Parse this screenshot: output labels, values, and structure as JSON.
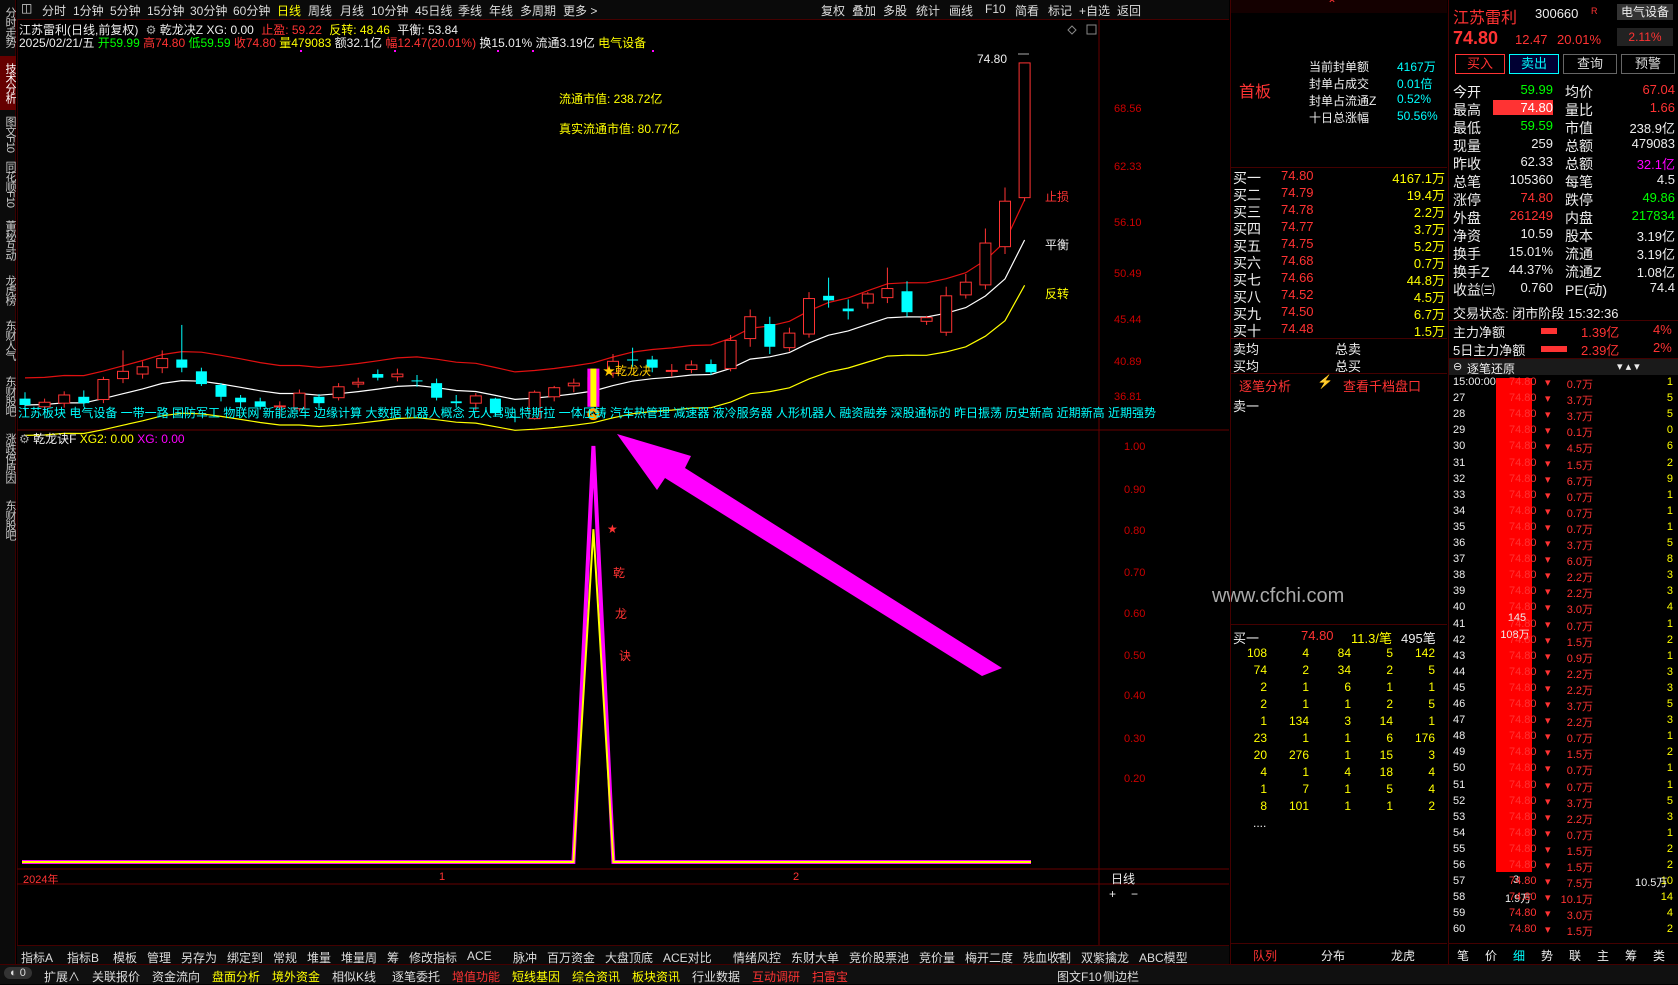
{
  "left_tabs": [
    "分时走势",
    "技术分析",
    "图文F10",
    "同花顺F10",
    "董秘互动",
    "龙虎榜",
    "东财人气",
    "东财股吧",
    "涨跌停原因",
    "东财股吧"
  ],
  "periods": [
    "分时",
    "1分钟",
    "5分钟",
    "15分钟",
    "30分钟",
    "60分钟",
    "日线",
    "周线",
    "月线",
    "10分钟",
    "45日线",
    "季线",
    "年线",
    "多周期",
    "更多 >"
  ],
  "active_period": "日线",
  "toolbar_right": [
    "复权",
    "叠加",
    "多股",
    "统计",
    "画线",
    "F10",
    "简看",
    "标记",
    "+自选",
    "返回"
  ],
  "chart": {
    "title": "江苏雷利(日线,前复权)",
    "indicator_name": "乾龙决Z",
    "xg": "XG: 0.00",
    "stop": "止盈: 59.22",
    "reverse": "反转: 48.46",
    "balance": "平衡: 53.84",
    "date": "2025/02/21/五",
    "open": "开59.99",
    "high": "高74.80",
    "low": "低59.59",
    "close": "收74.80",
    "vol": "量479083",
    "amount": "额32.1亿",
    "chg": "幅12.47(20.01%)",
    "turnover": "换15.01%",
    "float": "流通3.19亿",
    "sector": "电气设备",
    "annot1": "流通市值: 238.72亿",
    "annot2": "真实流通市值: 80.77亿",
    "price_max": "74.80",
    "signal": "★乾龙决",
    "line_labels": {
      "stop": "止损",
      "balance": "平衡",
      "reverse": "反转"
    },
    "yaxis": [
      "68.56",
      "62.33",
      "56.10",
      "50.49",
      "45.44",
      "40.89",
      "36.81"
    ],
    "concepts": "江苏板块 电气设备 一带一路 国防军工 物联网 新能源车 边缘计算 大数据 机器人概念 无人驾驶 特斯拉 一体压铸 汽车热管理 减速器 液冷服务器 人形机器人 融资融券 深股通标的 昨日振荡 历史新高 近期新高 近期强势"
  },
  "sub": {
    "name": "乾龙诀F",
    "xg2": "XG2: 0.00",
    "xg": "XG: 0.00",
    "yaxis": [
      "1.00",
      "0.90",
      "0.80",
      "0.70",
      "0.60",
      "0.50",
      "0.40",
      "0.30",
      "0.20"
    ],
    "star": "★",
    "vtext": [
      "乾",
      "龙",
      "诀"
    ],
    "watermark": "www.cfchi.com",
    "xlabels": [
      "2024年",
      "1",
      "2"
    ],
    "period_label": "日线"
  },
  "chart_data": {
    "type": "candlestick",
    "ylim": [
      35,
      76
    ],
    "candles": [
      {
        "o": 37.9,
        "h": 38.6,
        "l": 36.6,
        "c": 37.2
      },
      {
        "o": 37.0,
        "h": 37.9,
        "l": 36.3,
        "c": 37.5
      },
      {
        "o": 37.4,
        "h": 38.7,
        "l": 36.9,
        "c": 38.3
      },
      {
        "o": 38.1,
        "h": 38.8,
        "l": 37.0,
        "c": 37.4
      },
      {
        "o": 37.8,
        "h": 40.3,
        "l": 37.4,
        "c": 40.0
      },
      {
        "o": 40.1,
        "h": 43.2,
        "l": 39.6,
        "c": 40.9
      },
      {
        "o": 40.6,
        "h": 42.0,
        "l": 40.1,
        "c": 41.4
      },
      {
        "o": 41.3,
        "h": 43.2,
        "l": 40.7,
        "c": 42.3
      },
      {
        "o": 42.2,
        "h": 46.0,
        "l": 40.8,
        "c": 41.3
      },
      {
        "o": 40.9,
        "h": 41.3,
        "l": 39.3,
        "c": 39.5
      },
      {
        "o": 39.4,
        "h": 39.6,
        "l": 37.6,
        "c": 38.1
      },
      {
        "o": 38.0,
        "h": 38.3,
        "l": 36.8,
        "c": 37.5
      },
      {
        "o": 37.6,
        "h": 38.0,
        "l": 36.7,
        "c": 37.0
      },
      {
        "o": 37.0,
        "h": 37.6,
        "l": 35.9,
        "c": 37.1
      },
      {
        "o": 36.8,
        "h": 38.9,
        "l": 36.5,
        "c": 38.5
      },
      {
        "o": 38.1,
        "h": 38.4,
        "l": 36.8,
        "c": 37.4
      },
      {
        "o": 38.0,
        "h": 39.6,
        "l": 37.7,
        "c": 39.2
      },
      {
        "o": 39.5,
        "h": 40.2,
        "l": 39.1,
        "c": 39.7
      },
      {
        "o": 40.6,
        "h": 41.1,
        "l": 39.9,
        "c": 40.2
      },
      {
        "o": 40.3,
        "h": 41.2,
        "l": 39.8,
        "c": 40.6
      },
      {
        "o": 39.9,
        "h": 40.5,
        "l": 39.2,
        "c": 39.8
      },
      {
        "o": 39.6,
        "h": 40.1,
        "l": 37.7,
        "c": 38.0
      },
      {
        "o": 37.6,
        "h": 38.3,
        "l": 36.9,
        "c": 37.4
      },
      {
        "o": 37.4,
        "h": 38.5,
        "l": 36.6,
        "c": 38.2
      },
      {
        "o": 37.9,
        "h": 38.0,
        "l": 35.9,
        "c": 36.3
      },
      {
        "o": 35.9,
        "h": 36.6,
        "l": 35.3,
        "c": 35.8
      },
      {
        "o": 35.7,
        "h": 38.8,
        "l": 35.6,
        "c": 38.6
      },
      {
        "o": 38.1,
        "h": 39.3,
        "l": 37.6,
        "c": 39.1
      },
      {
        "o": 39.3,
        "h": 40.1,
        "l": 38.6,
        "c": 39.6
      },
      {
        "o": 38.2,
        "h": 40.9,
        "l": 37.8,
        "c": 40.2
      },
      {
        "o": 40.7,
        "h": 42.8,
        "l": 40.2,
        "c": 42.0
      },
      {
        "o": 42.2,
        "h": 43.5,
        "l": 41.4,
        "c": 42.1
      },
      {
        "o": 42.2,
        "h": 42.6,
        "l": 40.8,
        "c": 41.3
      },
      {
        "o": 41.0,
        "h": 41.7,
        "l": 40.3,
        "c": 41.0
      },
      {
        "o": 41.1,
        "h": 42.1,
        "l": 40.7,
        "c": 41.6
      },
      {
        "o": 41.7,
        "h": 42.2,
        "l": 40.5,
        "c": 40.8
      },
      {
        "o": 41.2,
        "h": 44.9,
        "l": 40.9,
        "c": 44.3
      },
      {
        "o": 44.5,
        "h": 47.7,
        "l": 43.6,
        "c": 46.9
      },
      {
        "o": 46.1,
        "h": 46.9,
        "l": 42.8,
        "c": 43.6
      },
      {
        "o": 43.5,
        "h": 45.7,
        "l": 43.1,
        "c": 45.1
      },
      {
        "o": 45.0,
        "h": 49.6,
        "l": 44.6,
        "c": 48.9
      },
      {
        "o": 49.2,
        "h": 51.2,
        "l": 47.9,
        "c": 48.7
      },
      {
        "o": 47.8,
        "h": 48.8,
        "l": 46.6,
        "c": 47.5
      },
      {
        "o": 48.4,
        "h": 49.6,
        "l": 47.8,
        "c": 49.4
      },
      {
        "o": 49.0,
        "h": 52.3,
        "l": 48.4,
        "c": 50.0
      },
      {
        "o": 49.7,
        "h": 50.8,
        "l": 46.9,
        "c": 47.4
      },
      {
        "o": 46.4,
        "h": 47.0,
        "l": 46.0,
        "c": 46.8
      },
      {
        "o": 45.2,
        "h": 50.2,
        "l": 44.8,
        "c": 49.2
      },
      {
        "o": 49.3,
        "h": 51.6,
        "l": 48.9,
        "c": 50.7
      },
      {
        "o": 50.4,
        "h": 56.6,
        "l": 49.9,
        "c": 55.0
      },
      {
        "o": 54.6,
        "h": 61.1,
        "l": 53.8,
        "c": 59.6
      },
      {
        "o": 59.99,
        "h": 74.8,
        "l": 59.59,
        "c": 74.8
      }
    ],
    "signal_index": 29,
    "signal_peak": 1.0,
    "signal_inner_peak": 0.8
  },
  "quote": {
    "name": "江苏雷利",
    "code": "300660",
    "tag": "R",
    "sector_btn": "电气设备",
    "price": "74.80",
    "chg": "12.47",
    "pct": "20.01%",
    "pct2": "2.11%",
    "btns": [
      "买入",
      "卖出",
      "查询",
      "预警"
    ],
    "first_board": "首板",
    "seal_rows": [
      [
        "当前封单额",
        "4167万"
      ],
      [
        "封单占成交",
        "0.01倍"
      ],
      [
        "封单占流通Z",
        "0.52%"
      ],
      [
        "十日总涨幅",
        "50.56%"
      ]
    ],
    "sell_label": "卖一",
    "bids": [
      [
        "买一",
        "74.80",
        "4167.1万"
      ],
      [
        "买二",
        "74.79",
        "19.4万"
      ],
      [
        "买三",
        "74.78",
        "2.2万"
      ],
      [
        "买四",
        "74.77",
        "3.7万"
      ],
      [
        "买五",
        "74.75",
        "5.2万"
      ],
      [
        "买六",
        "74.68",
        "0.7万"
      ],
      [
        "买七",
        "74.66",
        "44.8万"
      ],
      [
        "买八",
        "74.52",
        "4.5万"
      ],
      [
        "买九",
        "74.50",
        "6.7万"
      ],
      [
        "买十",
        "74.48",
        "1.5万"
      ]
    ],
    "avg": [
      [
        "卖均",
        "总卖"
      ],
      [
        "买均",
        "总买"
      ]
    ],
    "tab1": "逐笔分析",
    "tab2": "查看千档盘口",
    "q_sell": "卖一",
    "q_buy": [
      "买一",
      "74.80",
      "11.3/笔",
      "495笔"
    ],
    "queue": [
      [
        108,
        4,
        84,
        5,
        142
      ],
      [
        74,
        2,
        34,
        2,
        5
      ],
      [
        2,
        1,
        6,
        1,
        1
      ],
      [
        2,
        1,
        1,
        2,
        5
      ],
      [
        1,
        134,
        3,
        14,
        1
      ],
      [
        23,
        1,
        1,
        6,
        176
      ],
      [
        20,
        276,
        1,
        15,
        3
      ],
      [
        4,
        1,
        4,
        18,
        4
      ],
      [
        1,
        7,
        1,
        5,
        4
      ],
      [
        8,
        101,
        1,
        1,
        2
      ]
    ],
    "more": "....",
    "bottom_tabs": [
      "队列",
      "分布",
      "龙虎"
    ]
  },
  "stats": {
    "rows": [
      [
        [
          "今开",
          "59.99",
          "grn"
        ],
        [
          "均价",
          "67.04",
          "red"
        ]
      ],
      [
        [
          "最高",
          "74.80",
          "red"
        ],
        [
          "量比",
          "1.66",
          "red"
        ]
      ],
      [
        [
          "最低",
          "59.59",
          "grn"
        ],
        [
          "市值",
          "238.9亿",
          "wht"
        ]
      ],
      [
        [
          "现量",
          "259",
          "wht"
        ],
        [
          "总额",
          "479083",
          "wht"
        ]
      ],
      [
        [
          "昨收",
          "62.33",
          "wht"
        ],
        [
          "总额",
          "32.1亿",
          "mag"
        ]
      ],
      [
        [
          "总笔",
          "105360",
          "wht"
        ],
        [
          "每笔",
          "4.5",
          "wht"
        ]
      ],
      [
        [
          "涨停",
          "74.80",
          "red"
        ],
        [
          "跌停",
          "49.86",
          "grn"
        ]
      ],
      [
        [
          "外盘",
          "261249",
          "red"
        ],
        [
          "内盘",
          "217834",
          "grn"
        ]
      ],
      [
        [
          "净资",
          "10.59",
          "wht"
        ],
        [
          "股本",
          "3.19亿",
          "wht"
        ]
      ],
      [
        [
          "换手",
          "15.01%",
          "wht"
        ],
        [
          "流通",
          "3.19亿",
          "wht"
        ]
      ],
      [
        [
          "换手Z",
          "44.37%",
          "wht"
        ],
        [
          "流通Z",
          "1.08亿",
          "wht"
        ]
      ],
      [
        [
          "收益㈢",
          "0.760",
          "wht"
        ],
        [
          "PE(动)",
          "74.4",
          "wht"
        ]
      ]
    ],
    "trade_state": "交易状态: 闭市阶段 15:32:36",
    "flow1": [
      "主力净额",
      "1.39亿",
      "4%"
    ],
    "flow2": [
      "5日主力净额",
      "2.39亿",
      "2%"
    ],
    "tick_title": "逐笔还原",
    "ticks": [
      [
        "15:00:00",
        "74.80",
        "0.7万",
        "1"
      ],
      [
        "27",
        "74.80",
        "3.7万",
        "5"
      ],
      [
        "28",
        "74.80",
        "3.7万",
        "5"
      ],
      [
        "29",
        "74.80",
        "0.1万",
        "0"
      ],
      [
        "30",
        "74.80",
        "4.5万",
        "6"
      ],
      [
        "31",
        "74.80",
        "1.5万",
        "2"
      ],
      [
        "32",
        "74.80",
        "6.7万",
        "9"
      ],
      [
        "33",
        "74.80",
        "0.7万",
        "1"
      ],
      [
        "34",
        "74.80",
        "0.7万",
        "1"
      ],
      [
        "35",
        "74.80",
        "0.7万",
        "1"
      ],
      [
        "36",
        "74.80",
        "3.7万",
        "5"
      ],
      [
        "37",
        "74.80",
        "6.0万",
        "8"
      ],
      [
        "38",
        "74.80",
        "2.2万",
        "3"
      ],
      [
        "39",
        "74.80",
        "2.2万",
        "3"
      ],
      [
        "40",
        "74.80",
        "3.0万",
        "4"
      ],
      [
        "41",
        "74.80",
        "0.7万",
        "1"
      ],
      [
        "42",
        "74.80",
        "1.5万",
        "2"
      ],
      [
        "43",
        "74.80",
        "0.9万",
        "1"
      ],
      [
        "44",
        "74.80",
        "2.2万",
        "3"
      ],
      [
        "45",
        "74.80",
        "2.2万",
        "3"
      ],
      [
        "46",
        "74.80",
        "3.7万",
        "5"
      ],
      [
        "47",
        "74.80",
        "2.2万",
        "3"
      ],
      [
        "48",
        "74.80",
        "0.7万",
        "1"
      ],
      [
        "49",
        "74.80",
        "1.5万",
        "2"
      ],
      [
        "50",
        "74.80",
        "0.7万",
        "1"
      ],
      [
        "51",
        "74.80",
        "0.7万",
        "1"
      ],
      [
        "52",
        "74.80",
        "3.7万",
        "5"
      ],
      [
        "53",
        "74.80",
        "2.2万",
        "3"
      ],
      [
        "54",
        "74.80",
        "0.7万",
        "1"
      ],
      [
        "55",
        "74.80",
        "1.5万",
        "2"
      ],
      [
        "56",
        "74.80",
        "1.5万",
        "2"
      ],
      [
        "57",
        "74.80",
        "7.5万",
        "10"
      ],
      [
        "58",
        "74.80",
        "10.1万",
        "14"
      ],
      [
        "59",
        "74.80",
        "3.0万",
        "4"
      ],
      [
        "60",
        "74.80",
        "1.5万",
        "2"
      ]
    ],
    "bar_label1": "145",
    "bar_label2": "108万",
    "bar_bottom1": "3",
    "bar_bottom2": "1.9万",
    "bar_bottom3": "10.5万",
    "bottom_tabs": [
      "笔",
      "价",
      "细",
      "势",
      "联",
      "主",
      "筹",
      "类"
    ]
  },
  "bottom_indicators": [
    "指标A",
    "指标B",
    "模板",
    "管理",
    "另存为",
    "绑定到",
    "常规",
    "堆量",
    "堆量周",
    "筹",
    "修改指标",
    "ACE",
    "脉冲",
    "百万资金",
    "大盘顶底",
    "ACE对比",
    "情绪风控",
    "东财大单",
    "竞价股票池",
    "竞价量",
    "梅开二度",
    "残血收割",
    "双紫擒龙",
    "ABC模型"
  ],
  "status_items": [
    "扩展∧",
    "关联报价",
    "资金流向",
    "盘面分析",
    "境外资金",
    "相似K线",
    "逐笔委托",
    "增值功能",
    "短线基因",
    "综合资讯",
    "板块资讯",
    "行业数据",
    "互动调研",
    "扫雷宝",
    "图文F10",
    "侧边栏"
  ],
  "colors": {
    "up": "#ff3333",
    "down": "#00ffff",
    "stop_line": "#e01010",
    "balance_line": "#ffffff",
    "reverse_line": "#ffff00",
    "signal": "#ff00ff",
    "accent": "#ff0000"
  }
}
